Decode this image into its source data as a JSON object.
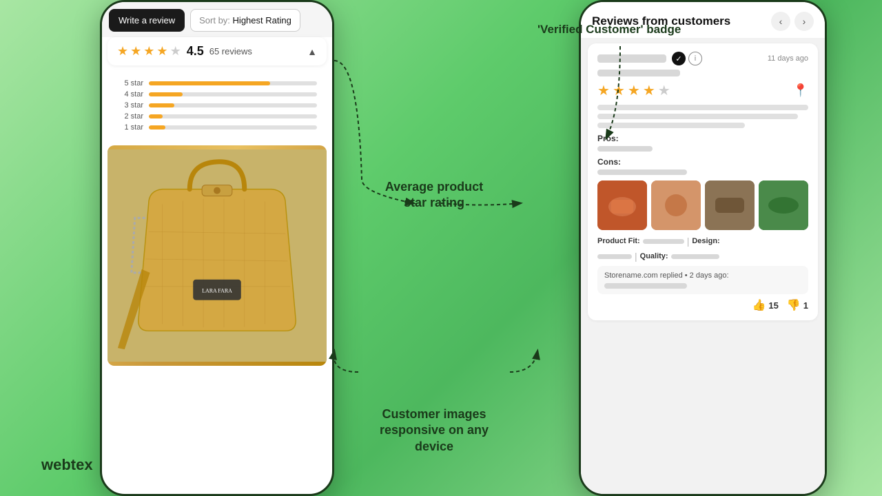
{
  "brand": "webtex",
  "annotations": {
    "verified_badge": "'Verified Customer' badge",
    "avg_rating": "Average product\nstar rating",
    "customer_images": "Customer images\nresponsive on any\ndevice"
  },
  "left_phone": {
    "write_review_btn": "Write a review",
    "sort_by_label": "Sort by:",
    "sort_by_value": "Highest Rating",
    "rating": "4.5",
    "reviews_count": "65 reviews",
    "star_bars": [
      {
        "label": "5 star",
        "fill": 72
      },
      {
        "label": "4 star",
        "fill": 20
      },
      {
        "label": "3 star",
        "fill": 15
      },
      {
        "label": "2 star",
        "fill": 8
      },
      {
        "label": "1 star",
        "fill": 10
      }
    ]
  },
  "right_phone": {
    "reviews_title": "Reviews from customers",
    "date": "11 days ago",
    "rating_value": 4,
    "pros_label": "Pros:",
    "cons_label": "Cons:",
    "product_fit_label": "Product Fit:",
    "design_label": "Design:",
    "quality_label": "Quality:",
    "store_reply_text": "Storename.com replied • 2 days ago:",
    "helpful_count": "15",
    "unhelpful_count": "1"
  }
}
